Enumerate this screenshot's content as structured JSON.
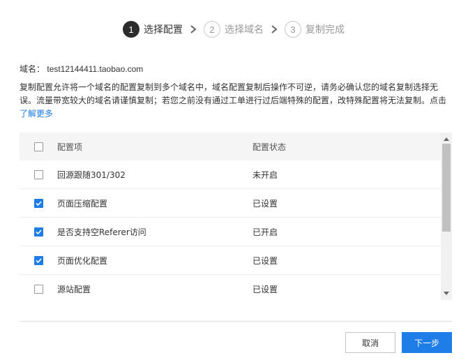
{
  "steps": [
    {
      "num": "1",
      "label": "选择配置",
      "state": "active"
    },
    {
      "num": "2",
      "label": "选择域名",
      "state": "todo"
    },
    {
      "num": "3",
      "label": "复制完成",
      "state": "todo"
    }
  ],
  "domain": {
    "label": "域名：",
    "value": "test12144411.taobao.com"
  },
  "description": {
    "line1": "复制配置允许将一个域名的配置复制到多个域名中，域名配置复制后操作不可逆，请务必确认您的域名复制选择无",
    "line2": "误。流量带宽较大的域名请谨慎复制；若您之前没有通过工单进行过后端特殊的配置，改特殊配置将无法复制。点击",
    "link": "了解更多"
  },
  "table": {
    "header": {
      "name": "配置项",
      "status": "配置状态",
      "checked": false
    },
    "rows": [
      {
        "name": "回源跟随301/302",
        "status": "未开启",
        "checked": false
      },
      {
        "name": "页面压缩配置",
        "status": "已设置",
        "checked": true
      },
      {
        "name": "是否支持空Referer访问",
        "status": "已开启",
        "checked": true
      },
      {
        "name": "页面优化配置",
        "status": "已设置",
        "checked": true
      },
      {
        "name": "源站配置",
        "status": "已设置",
        "checked": false
      }
    ]
  },
  "buttons": {
    "cancel": "取消",
    "next": "下一步"
  },
  "colors": {
    "primary": "#1e7de6",
    "step_active": "#2b2b2b",
    "step_todo": "#9a9a9a"
  }
}
